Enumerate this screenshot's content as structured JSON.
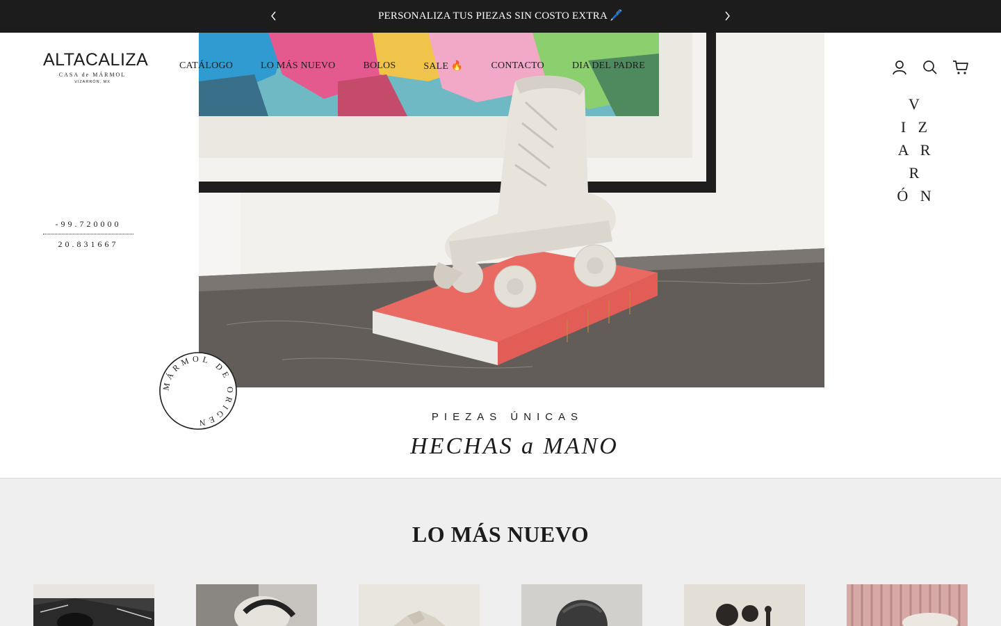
{
  "announcement": {
    "text": "PERSONALIZA TUS PIEZAS SIN COSTO EXTRA 🖊️",
    "prev_icon": "chevron-left-icon",
    "next_icon": "chevron-right-icon"
  },
  "header": {
    "logo": {
      "main": "ALTACALIZA",
      "sub": "CASA de MÁRMOL",
      "location": "VIZARRÓN, MX"
    },
    "nav": [
      {
        "label": "CATÁLOGO"
      },
      {
        "label": "LO MÁS NUEVO"
      },
      {
        "label": "BOLOS"
      },
      {
        "label": "SALE 🔥"
      },
      {
        "label": "CONTACTO"
      },
      {
        "label": "DIA DEL PADRE"
      }
    ],
    "icons": [
      "account-icon",
      "search-icon",
      "cart-icon"
    ]
  },
  "hero": {
    "vizarron_lines": [
      "V",
      "I Z",
      "A R R",
      "Ó N"
    ],
    "coordinates": {
      "longitude": "-99.720000",
      "latitude": "20.831667"
    },
    "stamp_text": "MÁRMOL DE ORIGEN",
    "tagline_top": "PIEZAS ÚNICAS",
    "tagline_bottom": "HECHAS a MANO",
    "colors": {
      "book": "#e8645f",
      "marble": "#e9e6e0",
      "table": "#5d5855"
    }
  },
  "new_section": {
    "title": "LO MÁS NUEVO",
    "products": [
      {
        "name": "product-1"
      },
      {
        "name": "product-2"
      },
      {
        "name": "product-3"
      },
      {
        "name": "product-4"
      },
      {
        "name": "product-5"
      },
      {
        "name": "product-6"
      }
    ]
  }
}
